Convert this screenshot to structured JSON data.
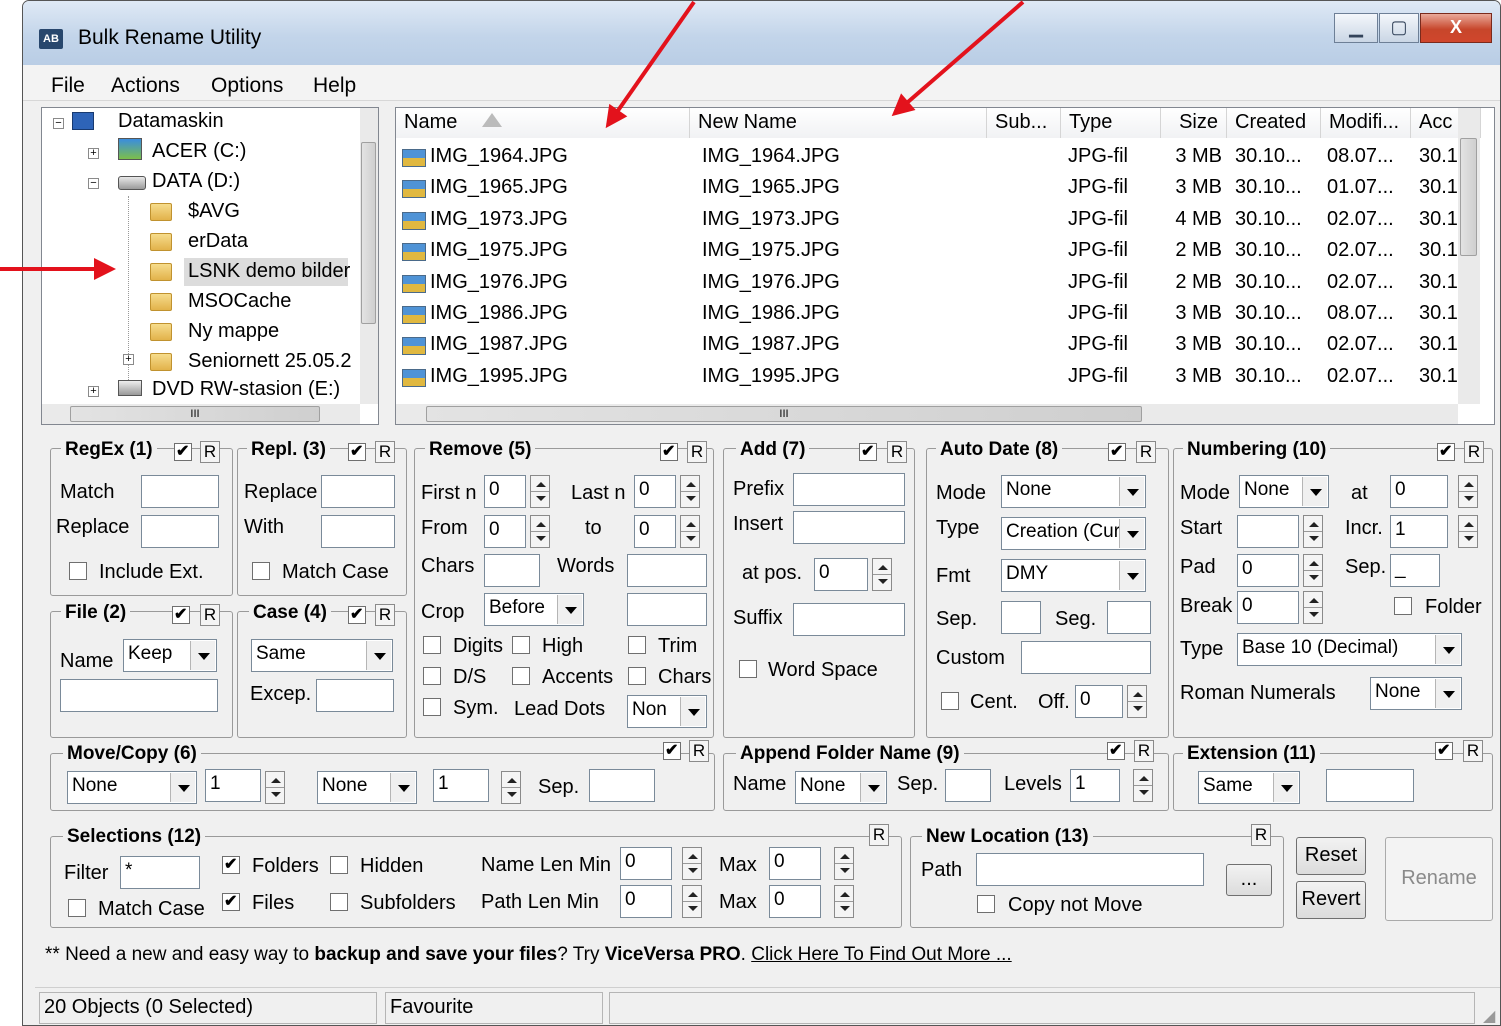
{
  "window": {
    "title": "Bulk Rename Utility",
    "controls": {
      "min": "▁",
      "max": "▢",
      "close": "X"
    }
  },
  "menu": [
    "File",
    "Actions",
    "Options",
    "Help"
  ],
  "tree": {
    "items": [
      {
        "label": "Datamaskin",
        "icon": "computer-icon"
      },
      {
        "label": "ACER (C:)",
        "icon": "drive-icon"
      },
      {
        "label": "DATA (D:)",
        "icon": "drive-icon"
      },
      {
        "label": "$AVG",
        "icon": "folder-icon"
      },
      {
        "label": "erData",
        "icon": "folder-icon"
      },
      {
        "label": "LSNK demo bilder",
        "icon": "folder-icon",
        "selected": true
      },
      {
        "label": "MSOCache",
        "icon": "folder-icon"
      },
      {
        "label": "Ny mappe",
        "icon": "folder-icon"
      },
      {
        "label": "Seniornett 25.05.2",
        "icon": "folder-icon"
      },
      {
        "label": "DVD RW-stasion (E:)",
        "icon": "dvd-icon"
      }
    ],
    "hscroll_thumb": "III"
  },
  "filelist": {
    "columns": [
      "Name",
      "New Name",
      "Sub...",
      "Type",
      "Size",
      "Created",
      "Modifi...",
      "Acc"
    ],
    "rows": [
      [
        "IMG_1964.JPG",
        "IMG_1964.JPG",
        "",
        "JPG-fil",
        "3 MB",
        "30.10...",
        "08.07...",
        "30.1"
      ],
      [
        "IMG_1965.JPG",
        "IMG_1965.JPG",
        "",
        "JPG-fil",
        "3 MB",
        "30.10...",
        "01.07...",
        "30.1"
      ],
      [
        "IMG_1973.JPG",
        "IMG_1973.JPG",
        "",
        "JPG-fil",
        "4 MB",
        "30.10...",
        "02.07...",
        "30.1"
      ],
      [
        "IMG_1975.JPG",
        "IMG_1975.JPG",
        "",
        "JPG-fil",
        "2 MB",
        "30.10...",
        "02.07...",
        "30.1"
      ],
      [
        "IMG_1976.JPG",
        "IMG_1976.JPG",
        "",
        "JPG-fil",
        "2 MB",
        "30.10...",
        "02.07...",
        "30.1"
      ],
      [
        "IMG_1986.JPG",
        "IMG_1986.JPG",
        "",
        "JPG-fil",
        "3 MB",
        "30.10...",
        "08.07...",
        "30.1"
      ],
      [
        "IMG_1987.JPG",
        "IMG_1987.JPG",
        "",
        "JPG-fil",
        "3 MB",
        "30.10...",
        "02.07...",
        "30.1"
      ],
      [
        "IMG_1995.JPG",
        "IMG_1995.JPG",
        "",
        "JPG-fil",
        "3 MB",
        "30.10...",
        "02.07...",
        "30.1"
      ]
    ],
    "hscroll_thumb": "III"
  },
  "regex": {
    "title": "RegEx (1)",
    "match": "Match",
    "replace": "Replace",
    "include_ext": "Include Ext.",
    "r": "R"
  },
  "repl": {
    "title": "Repl. (3)",
    "replace": "Replace",
    "with": "With",
    "match_case": "Match Case",
    "r": "R"
  },
  "remove": {
    "title": "Remove (5)",
    "first_n": "First n",
    "first_n_val": "0",
    "last_n": "Last n",
    "last_n_val": "0",
    "from": "From",
    "from_val": "0",
    "to": "to",
    "to_val": "0",
    "chars": "Chars",
    "words": "Words",
    "crop": "Crop",
    "crop_val": "Before",
    "digits": "Digits",
    "high": "High",
    "trim": "Trim",
    "ds": "D/S",
    "accents": "Accents",
    "chars2": "Chars",
    "sym": "Sym.",
    "lead_dots": "Lead Dots",
    "lead_dots_val": "Non",
    "r": "R"
  },
  "add": {
    "title": "Add (7)",
    "prefix": "Prefix",
    "insert": "Insert",
    "at_pos": "at pos.",
    "at_pos_val": "0",
    "suffix": "Suffix",
    "word_space": "Word Space",
    "r": "R"
  },
  "autodate": {
    "title": "Auto Date (8)",
    "mode": "Mode",
    "mode_val": "None",
    "type": "Type",
    "type_val": "Creation (Cur",
    "fmt": "Fmt",
    "fmt_val": "DMY",
    "sep": "Sep.",
    "seg": "Seg.",
    "custom": "Custom",
    "cent": "Cent.",
    "off": "Off.",
    "off_val": "0",
    "r": "R"
  },
  "numbering": {
    "title": "Numbering (10)",
    "mode": "Mode",
    "mode_val": "None",
    "at": "at",
    "at_val": "0",
    "start": "Start",
    "incr": "Incr.",
    "incr_val": "1",
    "pad": "Pad",
    "pad_val": "0",
    "sep": "Sep.",
    "sep_val": "_",
    "break": "Break",
    "break_val": "0",
    "folder": "Folder",
    "type": "Type",
    "type_val": "Base 10 (Decimal)",
    "roman": "Roman Numerals",
    "roman_val": "None",
    "r": "R"
  },
  "file": {
    "title": "File (2)",
    "name": "Name",
    "name_val": "Keep",
    "r": "R"
  },
  "case": {
    "title": "Case (4)",
    "case_val": "Same",
    "excep": "Excep.",
    "r": "R"
  },
  "movecopy": {
    "title": "Move/Copy (6)",
    "mode1": "None",
    "num1": "1",
    "mode2": "None",
    "num2": "1",
    "sep": "Sep.",
    "r": "R"
  },
  "appendfolder": {
    "title": "Append Folder Name (9)",
    "name": "Name",
    "name_val": "None",
    "sep": "Sep.",
    "levels": "Levels",
    "levels_val": "1",
    "r": "R"
  },
  "extension": {
    "title": "Extension (11)",
    "val": "Same",
    "r": "R"
  },
  "selections": {
    "title": "Selections (12)",
    "filter": "Filter",
    "filter_val": "*",
    "folders": "Folders",
    "hidden": "Hidden",
    "files": "Files",
    "subfolders": "Subfolders",
    "match_case": "Match Case",
    "name_len_min": "Name Len Min",
    "name_len_min_val": "0",
    "path_len_min": "Path Len Min",
    "path_len_min_val": "0",
    "max": "Max",
    "max1_val": "0",
    "max2_val": "0",
    "r": "R"
  },
  "newlocation": {
    "title": "New Location (13)",
    "path": "Path",
    "browse": "...",
    "copy_not_move": "Copy not Move",
    "r": "R"
  },
  "buttons": {
    "reset": "Reset",
    "revert": "Revert",
    "rename": "Rename"
  },
  "promo": {
    "pre": "** Need a new and easy way to ",
    "bold": "backup and save your files",
    "mid": "? Try ",
    "brand": "ViceVersa PRO",
    "post": ". ",
    "link": "Click Here To Find Out More ..."
  },
  "status": {
    "objects": "20 Objects (0 Selected)",
    "favourite": "Favourite"
  },
  "annotation_color": "#e3121c"
}
